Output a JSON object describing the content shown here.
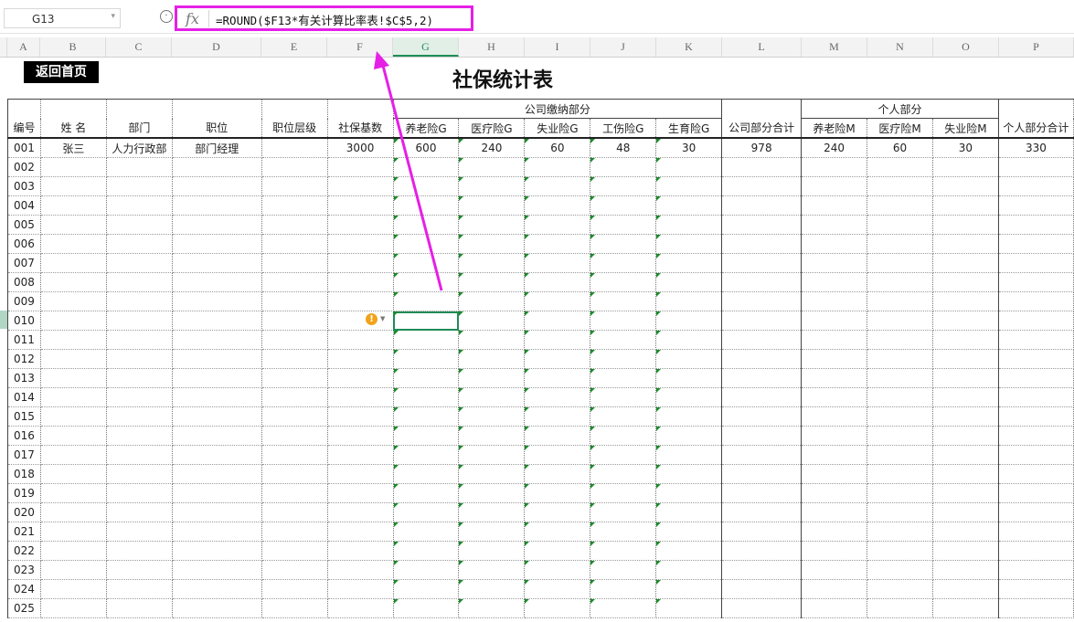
{
  "namebox": {
    "value": "G13"
  },
  "formula": {
    "fx": "fx",
    "text": "=ROUND($F13*有关计算比率表!$C$5,2)"
  },
  "columns": [
    "A",
    "B",
    "C",
    "D",
    "E",
    "F",
    "G",
    "H",
    "I",
    "J",
    "K",
    "L",
    "M",
    "N",
    "O",
    "P"
  ],
  "selected_column": "G",
  "back_button": "返回首页",
  "title": "社保统计表",
  "group_headers": {
    "company": "公司缴纳部分",
    "personal": "个人部分"
  },
  "headers": [
    "编号",
    "姓 名",
    "部门",
    "职位",
    "职位层级",
    "社保基数",
    "养老险G",
    "医疗险G",
    "失业险G",
    "工伤险G",
    "生育险G",
    "公司部分合计",
    "养老险M",
    "医疗险M",
    "失业险M",
    "个人部分合计"
  ],
  "rows": [
    [
      "001",
      "张三",
      "人力行政部",
      "部门经理",
      "",
      "3000",
      "600",
      "240",
      "60",
      "48",
      "30",
      "978",
      "240",
      "60",
      "30",
      "330"
    ],
    [
      "002",
      "",
      "",
      "",
      "",
      "",
      "",
      "",
      "",
      "",
      "",
      "",
      "",
      "",
      "",
      ""
    ],
    [
      "003",
      "",
      "",
      "",
      "",
      "",
      "",
      "",
      "",
      "",
      "",
      "",
      "",
      "",
      "",
      ""
    ],
    [
      "004",
      "",
      "",
      "",
      "",
      "",
      "",
      "",
      "",
      "",
      "",
      "",
      "",
      "",
      "",
      ""
    ],
    [
      "005",
      "",
      "",
      "",
      "",
      "",
      "",
      "",
      "",
      "",
      "",
      "",
      "",
      "",
      "",
      ""
    ],
    [
      "006",
      "",
      "",
      "",
      "",
      "",
      "",
      "",
      "",
      "",
      "",
      "",
      "",
      "",
      "",
      ""
    ],
    [
      "007",
      "",
      "",
      "",
      "",
      "",
      "",
      "",
      "",
      "",
      "",
      "",
      "",
      "",
      "",
      ""
    ],
    [
      "008",
      "",
      "",
      "",
      "",
      "",
      "",
      "",
      "",
      "",
      "",
      "",
      "",
      "",
      "",
      ""
    ],
    [
      "009",
      "",
      "",
      "",
      "",
      "",
      "",
      "",
      "",
      "",
      "",
      "",
      "",
      "",
      "",
      ""
    ],
    [
      "010",
      "",
      "",
      "",
      "",
      "",
      "",
      "",
      "",
      "",
      "",
      "",
      "",
      "",
      "",
      ""
    ],
    [
      "011",
      "",
      "",
      "",
      "",
      "",
      "",
      "",
      "",
      "",
      "",
      "",
      "",
      "",
      "",
      ""
    ],
    [
      "012",
      "",
      "",
      "",
      "",
      "",
      "",
      "",
      "",
      "",
      "",
      "",
      "",
      "",
      "",
      ""
    ],
    [
      "013",
      "",
      "",
      "",
      "",
      "",
      "",
      "",
      "",
      "",
      "",
      "",
      "",
      "",
      "",
      ""
    ],
    [
      "014",
      "",
      "",
      "",
      "",
      "",
      "",
      "",
      "",
      "",
      "",
      "",
      "",
      "",
      "",
      ""
    ],
    [
      "015",
      "",
      "",
      "",
      "",
      "",
      "",
      "",
      "",
      "",
      "",
      "",
      "",
      "",
      "",
      ""
    ],
    [
      "016",
      "",
      "",
      "",
      "",
      "",
      "",
      "",
      "",
      "",
      "",
      "",
      "",
      "",
      "",
      ""
    ],
    [
      "017",
      "",
      "",
      "",
      "",
      "",
      "",
      "",
      "",
      "",
      "",
      "",
      "",
      "",
      "",
      ""
    ],
    [
      "018",
      "",
      "",
      "",
      "",
      "",
      "",
      "",
      "",
      "",
      "",
      "",
      "",
      "",
      "",
      ""
    ],
    [
      "019",
      "",
      "",
      "",
      "",
      "",
      "",
      "",
      "",
      "",
      "",
      "",
      "",
      "",
      "",
      ""
    ],
    [
      "020",
      "",
      "",
      "",
      "",
      "",
      "",
      "",
      "",
      "",
      "",
      "",
      "",
      "",
      "",
      ""
    ],
    [
      "021",
      "",
      "",
      "",
      "",
      "",
      "",
      "",
      "",
      "",
      "",
      "",
      "",
      "",
      "",
      ""
    ],
    [
      "022",
      "",
      "",
      "",
      "",
      "",
      "",
      "",
      "",
      "",
      "",
      "",
      "",
      "",
      "",
      ""
    ],
    [
      "023",
      "",
      "",
      "",
      "",
      "",
      "",
      "",
      "",
      "",
      "",
      "",
      "",
      "",
      "",
      ""
    ],
    [
      "024",
      "",
      "",
      "",
      "",
      "",
      "",
      "",
      "",
      "",
      "",
      "",
      "",
      "",
      "",
      ""
    ],
    [
      "025",
      "",
      "",
      "",
      "",
      "",
      "",
      "",
      "",
      "",
      "",
      "",
      "",
      "",
      "",
      ""
    ]
  ],
  "colors": {
    "highlight": "#e61fe6",
    "accent": "#1f8c57",
    "warning": "#f2a31b"
  },
  "icons": {
    "fx": "function-icon",
    "warning": "warning-icon"
  },
  "warning_glyph": "!"
}
